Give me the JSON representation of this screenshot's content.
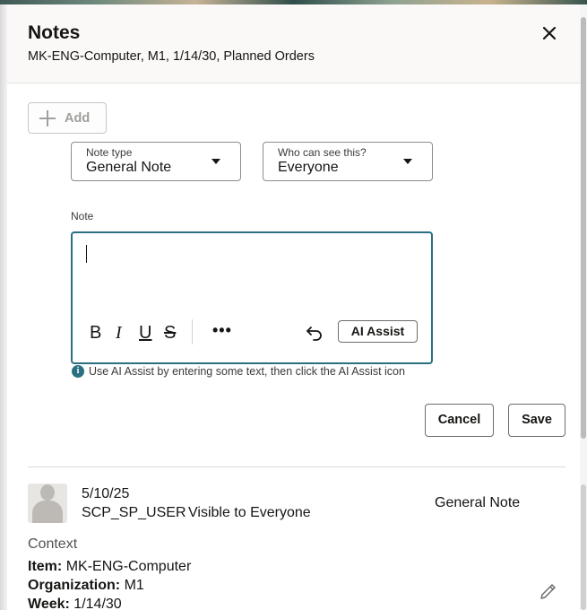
{
  "header": {
    "title": "Notes",
    "subtitle": "MK-ENG-Computer, M1, 1/14/30, Planned Orders"
  },
  "toolbar": {
    "add_label": "Add"
  },
  "form": {
    "note_type": {
      "label": "Note type",
      "value": "General Note"
    },
    "visibility": {
      "label": "Who can see this?",
      "value": "Everyone"
    },
    "note_label": "Note",
    "editor": {
      "more": "•••",
      "ai_assist": "AI Assist"
    },
    "hint": "Use AI Assist by entering some text, then click the AI Assist icon",
    "cancel_label": "Cancel",
    "save_label": "Save"
  },
  "note": {
    "date": "5/10/25",
    "user": "SCP_SP_USER",
    "visibility": "Visible to Everyone",
    "type": "General Note",
    "context_heading": "Context",
    "context": [
      {
        "label": "Item:",
        "value": "MK-ENG-Computer"
      },
      {
        "label": "Organization:",
        "value": "M1"
      },
      {
        "label": "Week:",
        "value": "1/14/30"
      }
    ]
  },
  "colors": {
    "accent": "#2a6f82",
    "header_bg": "#fbf9f8"
  }
}
